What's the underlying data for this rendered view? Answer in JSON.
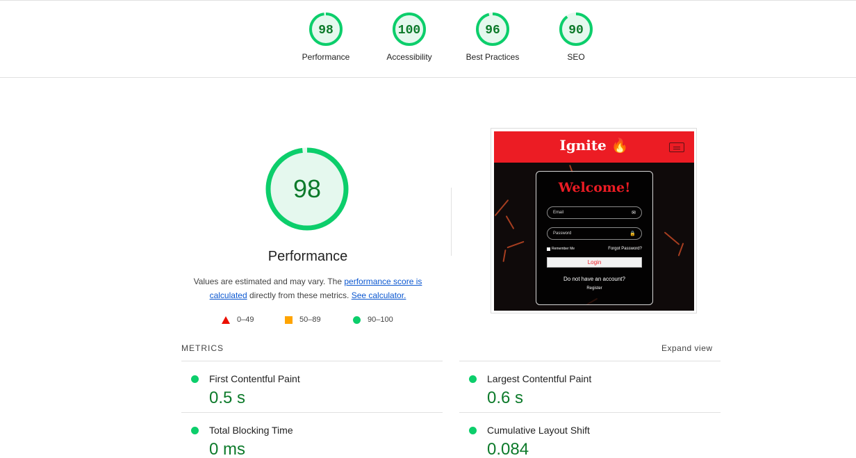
{
  "top_scores": [
    {
      "score": "98",
      "label": "Performance",
      "fraction": 0.98
    },
    {
      "score": "100",
      "label": "Accessibility",
      "fraction": 1.0
    },
    {
      "score": "96",
      "label": "Best Practices",
      "fraction": 0.96
    },
    {
      "score": "90",
      "label": "SEO",
      "fraction": 0.9
    }
  ],
  "main_gauge": {
    "score": "98",
    "fraction": 0.98,
    "title": "Performance"
  },
  "note": {
    "text_before": "Values are estimated and may vary. The ",
    "link1": "performance score is calculated",
    "text_middle": " directly from these metrics. ",
    "link2": "See calculator."
  },
  "legend": {
    "poor": "0–49",
    "average": "50–89",
    "good": "90–100"
  },
  "screenshot": {
    "brand": "Ignite 🔥",
    "heading": "Welcome!",
    "email_placeholder": "Email",
    "email_icon": "✉",
    "password_placeholder": "Password",
    "password_icon": "🔒",
    "remember": "Remember Me",
    "forgot": "Forgot Password?",
    "login": "Login",
    "no_account": "Do not have an account?",
    "register": "Register"
  },
  "metrics": {
    "title": "METRICS",
    "expand": "Expand view",
    "items": [
      {
        "name": "First Contentful Paint",
        "value": "0.5 s"
      },
      {
        "name": "Largest Contentful Paint",
        "value": "0.6 s"
      },
      {
        "name": "Total Blocking Time",
        "value": "0 ms"
      },
      {
        "name": "Cumulative Layout Shift",
        "value": "0.084"
      }
    ]
  },
  "colors": {
    "good": "#0cce6b",
    "good_text": "#0c7a2a",
    "good_fill": "#e5f8ee",
    "poor": "#eb0f00",
    "average": "#ffa400",
    "link": "#0b57d0"
  }
}
